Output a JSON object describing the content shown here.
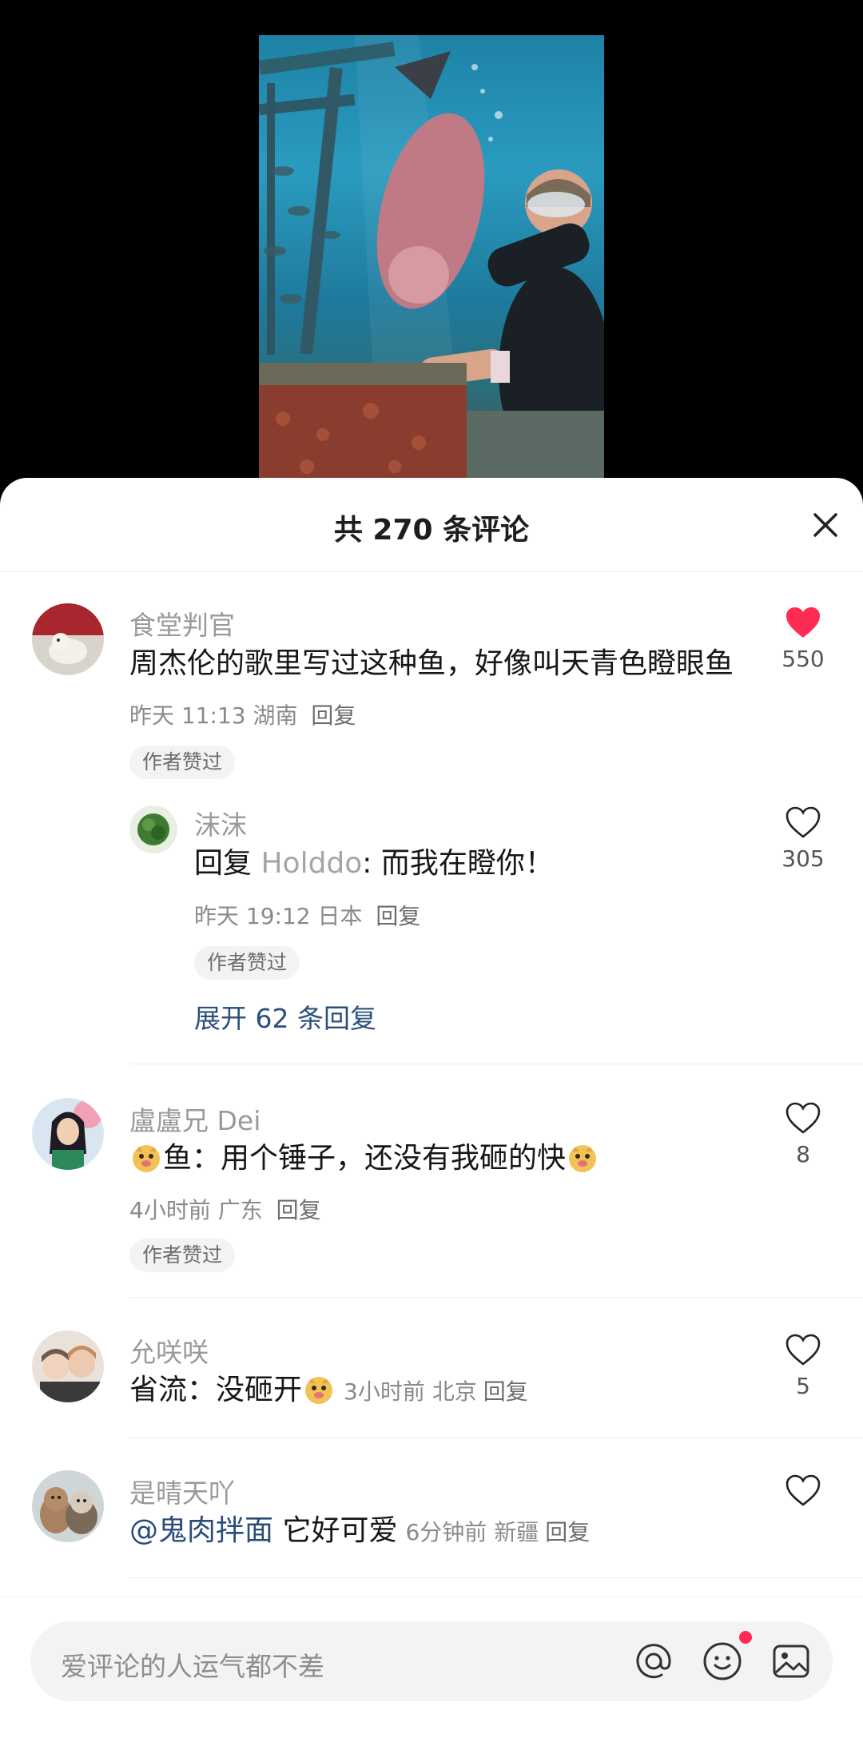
{
  "video": {
    "icon": "video-thumbnail"
  },
  "sheet": {
    "title": "共 270 条评论",
    "close_icon": "close-icon"
  },
  "comments": [
    {
      "username": "食堂判官",
      "text": "周杰伦的歌里写过这种鱼，好像叫天青色瞪眼鱼",
      "time": "昨天 11:13",
      "location": "湖南",
      "reply_label": "回复",
      "tag": "作者赞过",
      "likes": "550",
      "liked": true,
      "replies": [
        {
          "username": "沫沫",
          "reply_prefix": "回复",
          "reply_to": "Holddo",
          "text": ": 而我在瞪你！",
          "time": "昨天 19:12",
          "location": "日本",
          "reply_label": "回复",
          "tag": "作者赞过",
          "likes": "305"
        }
      ],
      "expand_label": "展开 62 条回复"
    },
    {
      "username": "盧盧兄 Dei",
      "text": "鱼：用个锤子，还没有我砸的快",
      "time": "4小时前",
      "location": "广东",
      "reply_label": "回复",
      "tag": "作者赞过",
      "likes": "8",
      "liked": false
    },
    {
      "username": "允咲咲",
      "text": "省流：没砸开",
      "time": "3小时前",
      "location": "北京",
      "reply_label": "回复",
      "likes": "5",
      "liked": false
    },
    {
      "username": "是晴天吖",
      "mention": "@鬼肉拌面",
      "text": " 它好可爱",
      "time": "6分钟前",
      "location": "新疆",
      "reply_label": "回复",
      "liked": false
    }
  ],
  "input": {
    "placeholder": "爱评论的人运气都不差",
    "icons": [
      "at-icon",
      "emoji-icon",
      "image-icon"
    ]
  },
  "colors": {
    "like_red": "#fe2c55",
    "mention_blue": "#2b4f7c",
    "meta_gray": "#8a8a8a"
  }
}
